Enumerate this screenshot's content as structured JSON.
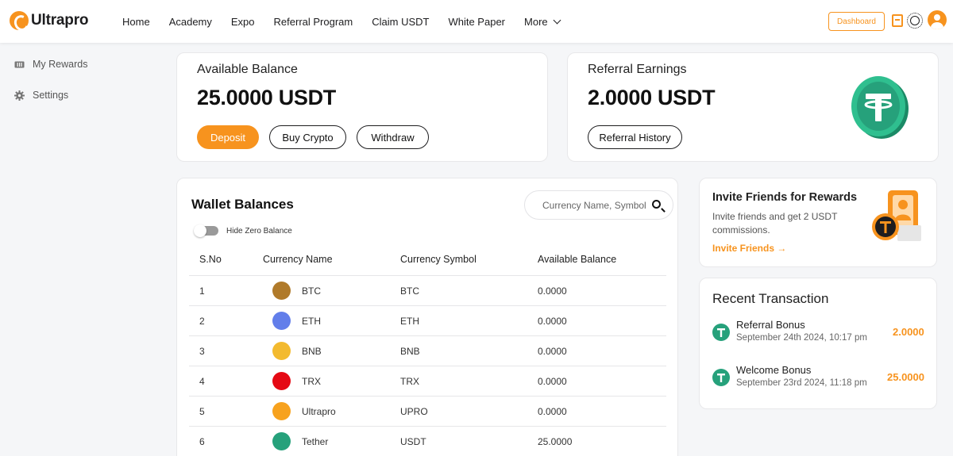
{
  "header": {
    "brand": "Ultrapro",
    "nav": [
      "Home",
      "Academy",
      "Expo",
      "Referral Program",
      "Claim USDT",
      "White Paper",
      "More"
    ],
    "dashboard_label": "Dashboard",
    "accent": "#f7931e"
  },
  "sidebar": {
    "items": [
      {
        "label": "My Rewards",
        "icon": "ticket-icon"
      },
      {
        "label": "Settings",
        "icon": "gear-icon"
      }
    ]
  },
  "balance": {
    "label": "Available Balance",
    "value": "25.0000 USDT",
    "buttons": [
      "Deposit",
      "Buy Crypto",
      "Withdraw"
    ]
  },
  "referral": {
    "label": "Referral Earnings",
    "value": "2.0000 USDT",
    "button": "Referral History"
  },
  "wallet": {
    "title": "Wallet Balances",
    "search_placeholder": "Currency Name, Symbol",
    "toggle_label": "Hide Zero Balance",
    "columns": [
      "S.No",
      "Currency Name",
      "Currency Symbol",
      "Available Balance"
    ],
    "rows": [
      {
        "no": "1",
        "name": "BTC",
        "symbol": "BTC",
        "balance": "0.0000",
        "color": "#b07a2a"
      },
      {
        "no": "2",
        "name": "ETH",
        "symbol": "ETH",
        "balance": "0.0000",
        "color": "#627eea"
      },
      {
        "no": "3",
        "name": "BNB",
        "symbol": "BNB",
        "balance": "0.0000",
        "color": "#f3ba2f"
      },
      {
        "no": "4",
        "name": "TRX",
        "symbol": "TRX",
        "balance": "0.0000",
        "color": "#e50914"
      },
      {
        "no": "5",
        "name": "Ultrapro",
        "symbol": "UPRO",
        "balance": "0.0000",
        "color": "#f7a21e"
      },
      {
        "no": "6",
        "name": "Tether",
        "symbol": "USDT",
        "balance": "25.0000",
        "color": "#26a17b"
      }
    ]
  },
  "invite": {
    "title": "Invite Friends for Rewards",
    "text": "Invite friends and get 2 USDT commissions.",
    "link": "Invite Friends →"
  },
  "recent": {
    "title": "Recent Transaction",
    "items": [
      {
        "name": "Referral Bonus",
        "date": "September 24th 2024, 10:17 pm",
        "amount": "2.0000"
      },
      {
        "name": "Welcome Bonus",
        "date": "September 23rd 2024, 11:18 pm",
        "amount": "25.0000"
      }
    ]
  }
}
